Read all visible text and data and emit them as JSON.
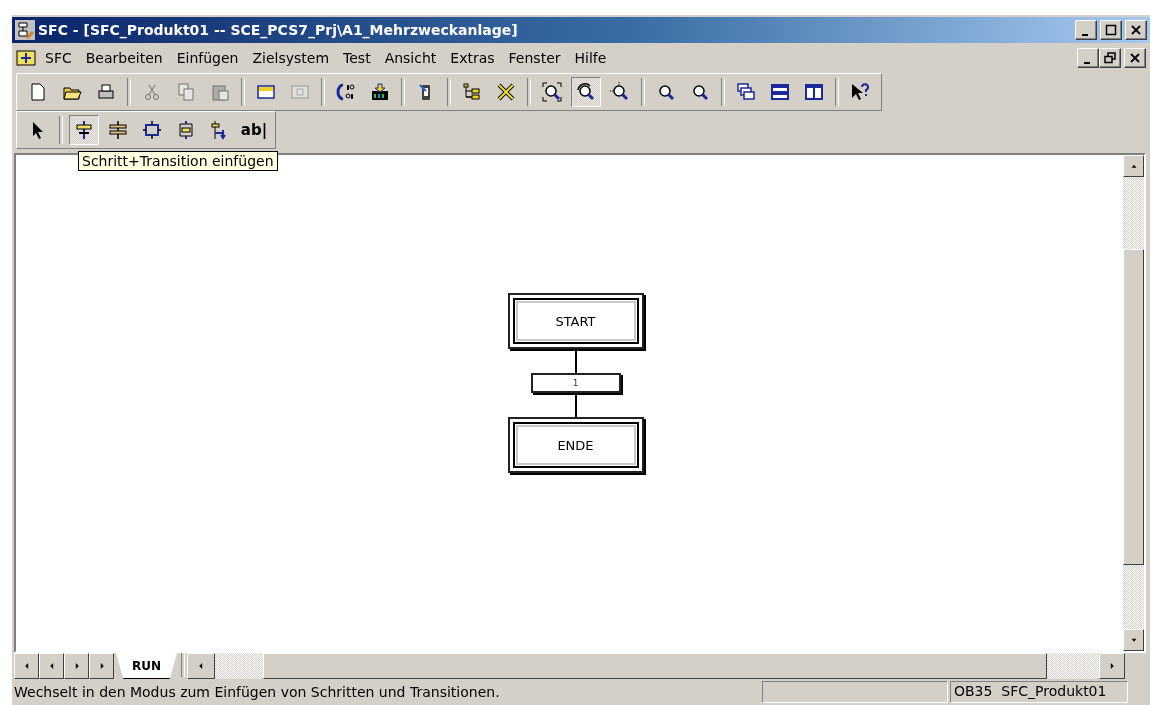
{
  "window": {
    "title": "SFC - [SFC_Produkt01 -- SCE_PCS7_Prj\\A1_Mehrzweckanlage]"
  },
  "menu": [
    {
      "label": "SFC"
    },
    {
      "label": "Bearbeiten"
    },
    {
      "label": "Einfügen"
    },
    {
      "label": "Zielsystem"
    },
    {
      "label": "Test"
    },
    {
      "label": "Ansicht"
    },
    {
      "label": "Extras"
    },
    {
      "label": "Fenster"
    },
    {
      "label": "Hilfe"
    }
  ],
  "toolbar": [
    {
      "kind": "button",
      "disabled": false,
      "selected": false
    },
    {
      "kind": "button",
      "disabled": false,
      "selected": false
    },
    {
      "kind": "button",
      "disabled": false,
      "selected": false
    },
    {
      "kind": "separator"
    },
    {
      "kind": "button",
      "disabled": true,
      "selected": false
    },
    {
      "kind": "button",
      "disabled": true,
      "selected": false
    },
    {
      "kind": "button",
      "disabled": true,
      "selected": false
    },
    {
      "kind": "separator"
    },
    {
      "kind": "button",
      "disabled": false,
      "selected": false
    },
    {
      "kind": "button",
      "disabled": true,
      "selected": false
    },
    {
      "kind": "separator"
    },
    {
      "kind": "button",
      "disabled": false,
      "selected": false
    },
    {
      "kind": "button",
      "disabled": false,
      "selected": false
    },
    {
      "kind": "separator"
    },
    {
      "kind": "button",
      "disabled": false,
      "selected": false
    },
    {
      "kind": "separator"
    },
    {
      "kind": "button",
      "disabled": false,
      "selected": false
    },
    {
      "kind": "button",
      "disabled": false,
      "selected": false
    },
    {
      "kind": "separator"
    },
    {
      "kind": "button",
      "disabled": false,
      "selected": false
    },
    {
      "kind": "button",
      "disabled": false,
      "selected": true
    },
    {
      "kind": "button",
      "disabled": false,
      "selected": false
    },
    {
      "kind": "separator"
    },
    {
      "kind": "button",
      "disabled": false,
      "selected": false
    },
    {
      "kind": "button",
      "disabled": false,
      "selected": false
    },
    {
      "kind": "separator"
    },
    {
      "kind": "button",
      "disabled": false,
      "selected": false
    },
    {
      "kind": "button",
      "disabled": false,
      "selected": false
    },
    {
      "kind": "button",
      "disabled": false,
      "selected": false
    },
    {
      "kind": "separator"
    },
    {
      "kind": "button",
      "disabled": false,
      "selected": false
    }
  ],
  "sfc_toolbar": [
    {
      "kind": "button",
      "selected": false
    },
    {
      "kind": "separator"
    },
    {
      "kind": "button",
      "selected": true
    },
    {
      "kind": "button",
      "selected": false
    },
    {
      "kind": "button",
      "selected": false
    },
    {
      "kind": "button",
      "selected": false
    },
    {
      "kind": "button",
      "selected": false
    },
    {
      "kind": "text",
      "label": "ab|",
      "selected": false
    }
  ],
  "tooltip": "Schritt+Transition einfügen",
  "diagram": {
    "steps": [
      {
        "name": "START"
      },
      {
        "name": "ENDE"
      }
    ],
    "transitions": [
      {
        "name": "1"
      }
    ]
  },
  "sheet_tabs": [
    {
      "label": "RUN",
      "selected": true
    }
  ],
  "status_bar": {
    "message": "Wechselt in den Modus zum Einfügen von Schritten und Transitionen.",
    "panels": [
      "OB35  SFC_Produkt01"
    ]
  }
}
